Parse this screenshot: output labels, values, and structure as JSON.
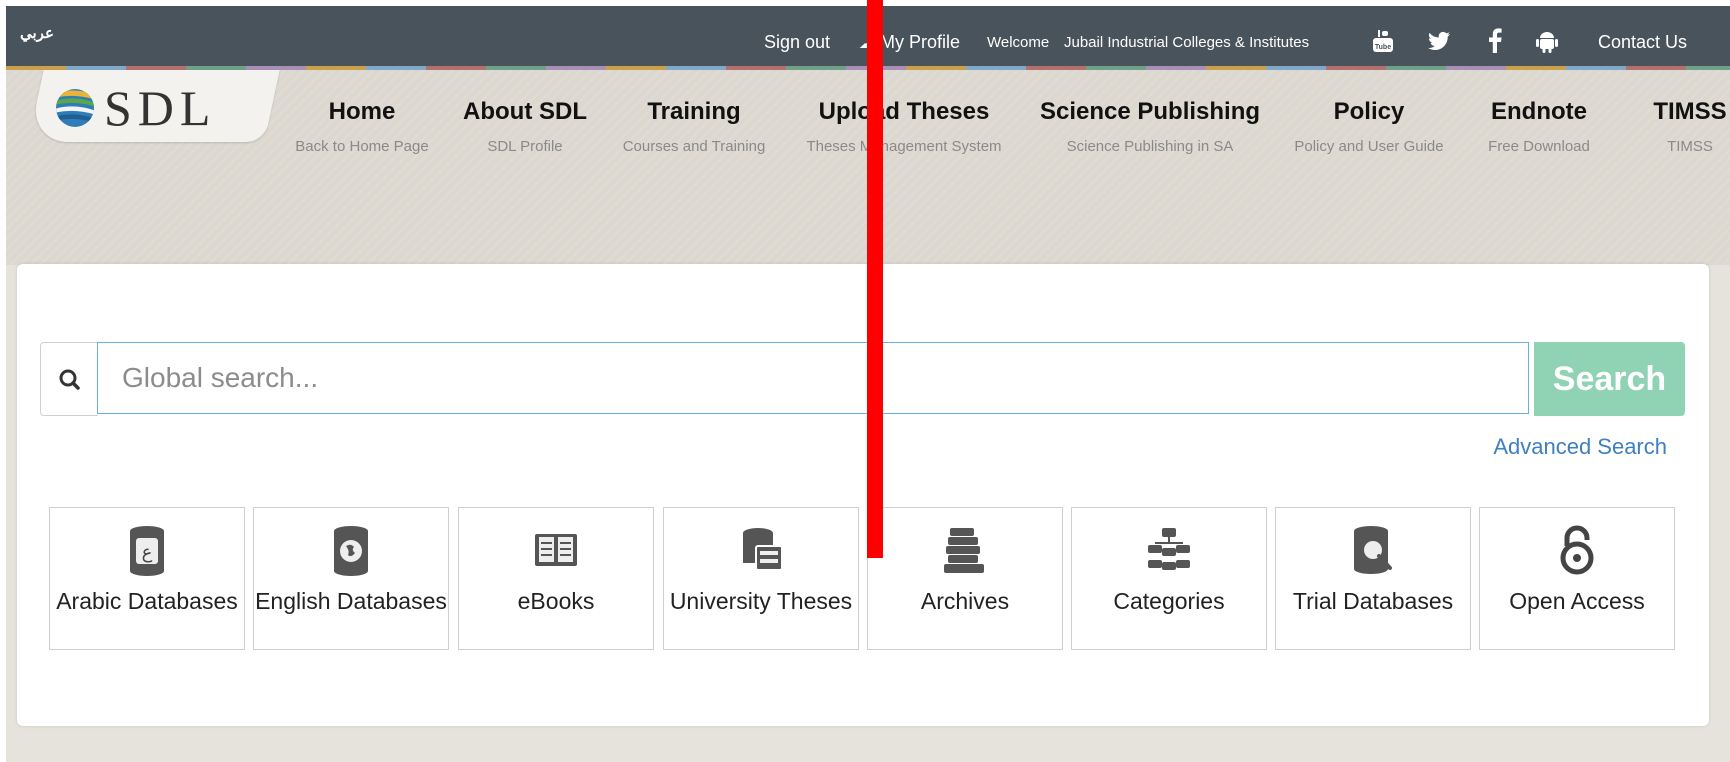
{
  "topbar": {
    "language": "عربي",
    "sign_out": "Sign out",
    "my_profile": "My Profile",
    "welcome": "Welcome",
    "institution": "Jubail Industrial Colleges & Institutes",
    "contact": "Contact Us",
    "social_icons": [
      "youtube-icon",
      "twitter-icon",
      "facebook-icon",
      "android-icon"
    ]
  },
  "logo": {
    "text": "SDL"
  },
  "nav": [
    {
      "title": "Home",
      "subtitle": "Back to Home Page"
    },
    {
      "title": "About SDL",
      "subtitle": "SDL Profile"
    },
    {
      "title": "Training",
      "subtitle": "Courses and Training"
    },
    {
      "title": "Upload Theses",
      "subtitle": "Theses Management System"
    },
    {
      "title": "Science Publishing",
      "subtitle": "Science Publishing in SA"
    },
    {
      "title": "Policy",
      "subtitle": "Policy and User Guide"
    },
    {
      "title": "Endnote",
      "subtitle": "Free Download"
    },
    {
      "title": "TIMSS",
      "subtitle": "TIMSS"
    }
  ],
  "search": {
    "placeholder": "Global search...",
    "button": "Search",
    "advanced": "Advanced Search"
  },
  "tiles": [
    {
      "label": "Arabic Databases",
      "icon": "arabic-database-icon"
    },
    {
      "label": "English Databases",
      "icon": "english-database-icon"
    },
    {
      "label": "eBooks",
      "icon": "book-icon"
    },
    {
      "label": "University Theses",
      "icon": "theses-icon"
    },
    {
      "label": "Archives",
      "icon": "archive-books-icon"
    },
    {
      "label": "Categories",
      "icon": "categories-icon"
    },
    {
      "label": "Trial Databases",
      "icon": "trial-database-icon"
    },
    {
      "label": "Open Access",
      "icon": "open-access-icon"
    }
  ],
  "colors": {
    "topbar": "#48535b",
    "search_button": "#8fd3b4",
    "link": "#3f7fbf",
    "overlay_bar": "#ff0000"
  }
}
